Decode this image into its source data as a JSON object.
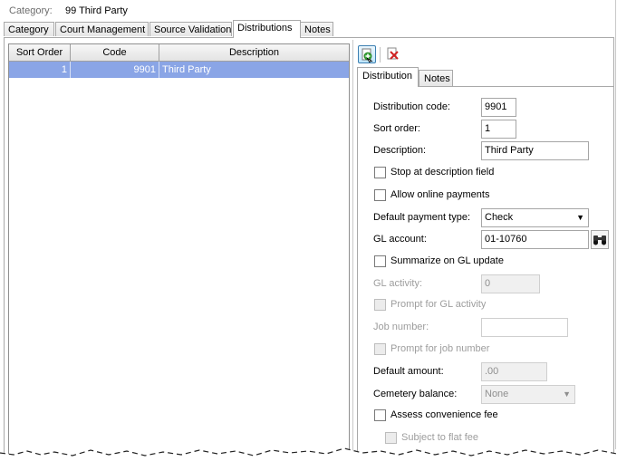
{
  "category": {
    "label": "Category:",
    "value": "99  Third Party"
  },
  "tabs": [
    {
      "label": "Category"
    },
    {
      "label": "Court Management"
    },
    {
      "label": "Source Validation"
    },
    {
      "label": "Distributions"
    },
    {
      "label": "Notes"
    }
  ],
  "grid": {
    "columns": [
      "Sort Order",
      "Code",
      "Description"
    ],
    "rows": [
      {
        "sort_order": "1",
        "code": "9901",
        "description": "Third Party"
      }
    ]
  },
  "toolbar": {
    "add_icon": "add-green-plus-icon",
    "delete_icon": "delete-red-x-icon"
  },
  "detail_tabs": [
    {
      "label": "Distribution"
    },
    {
      "label": "Notes"
    }
  ],
  "form": {
    "distribution_code": {
      "label": "Distribution code:",
      "value": "9901"
    },
    "sort_order": {
      "label": "Sort order:",
      "value": "1"
    },
    "description": {
      "label": "Description:",
      "value": "Third Party"
    },
    "stop_at_description": {
      "label": "Stop at description field",
      "checked": false
    },
    "allow_online_payments": {
      "label": "Allow online payments",
      "checked": false
    },
    "default_payment_type": {
      "label": "Default payment type:",
      "value": "Check"
    },
    "gl_account": {
      "label": "GL account:",
      "value": "01-10760"
    },
    "summarize_on_gl": {
      "label": "Summarize on GL update",
      "checked": false
    },
    "gl_activity": {
      "label": "GL activity:",
      "value": "0"
    },
    "prompt_gl_activity": {
      "label": "Prompt for GL activity",
      "checked": false
    },
    "job_number": {
      "label": "Job number:",
      "value": ""
    },
    "prompt_job_number": {
      "label": "Prompt for job number",
      "checked": false
    },
    "default_amount": {
      "label": "Default amount:",
      "value": ".00"
    },
    "cemetery_balance": {
      "label": "Cemetery balance:",
      "value": "None"
    },
    "assess_convenience_fee": {
      "label": "Assess convenience fee",
      "checked": false
    },
    "subject_to_flat_fee": {
      "label": "Subject to flat fee",
      "checked": false
    }
  }
}
